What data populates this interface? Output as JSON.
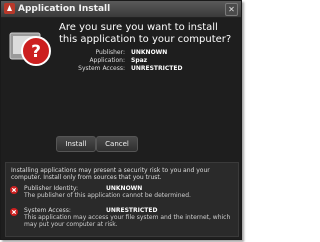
{
  "window": {
    "title": "Application Install"
  },
  "header": {
    "question": "Are you sure you want to install this application to your computer?",
    "details": [
      {
        "label": "Publisher:",
        "value": "UNKNOWN"
      },
      {
        "label": "Application:",
        "value": "Spaz"
      },
      {
        "label": "System Access:",
        "value": "UNRESTRICTED"
      }
    ]
  },
  "buttons": {
    "install": "Install",
    "cancel": "Cancel"
  },
  "warning": {
    "intro": "Installing applications may present a security risk to you and your computer. Install only from sources that you trust.",
    "items": [
      {
        "label": "Publisher Identity:",
        "value": "UNKNOWN",
        "desc": "The publisher of this application cannot be determined."
      },
      {
        "label": "System Access:",
        "value": "UNRESTRICTED",
        "desc": "This application may access your file system and the internet, which may put your computer at risk."
      }
    ]
  },
  "icons": {
    "window": "air-app-icon",
    "main": "question-mark-warning-icon",
    "item": "error-x-icon"
  },
  "colors": {
    "accent_red": "#cc1f1f",
    "background": "#1e1e1e"
  }
}
